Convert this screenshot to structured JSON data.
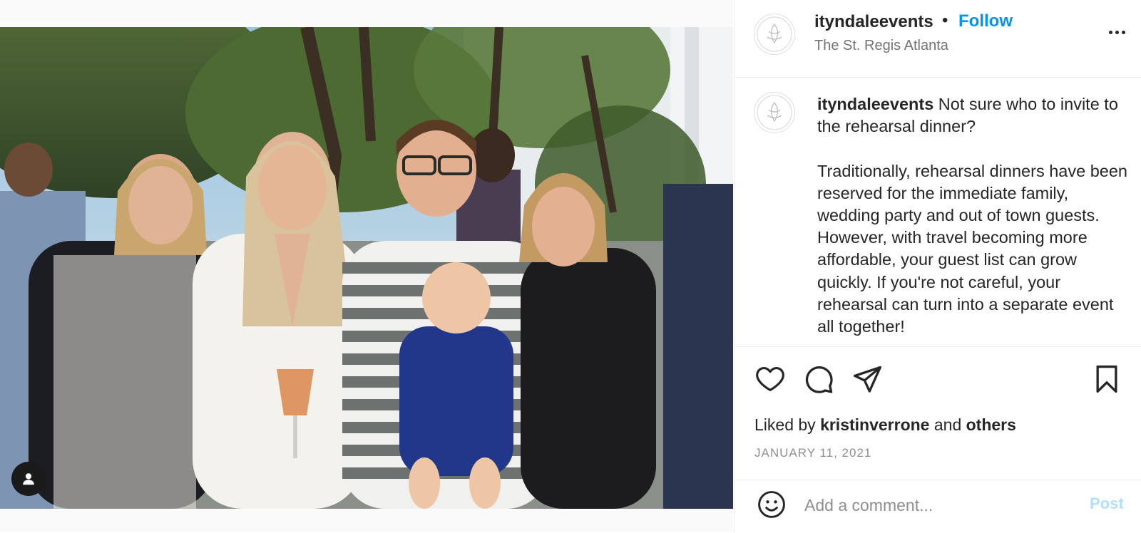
{
  "post": {
    "username": "ityndaleevents",
    "separator": "•",
    "follow_label": "Follow",
    "location": "The St. Regis Atlanta",
    "more_icon": "more-horizontal-icon",
    "avatar_icon": "brand-logo-avatar"
  },
  "caption": {
    "username": "ityndaleevents",
    "text": " Not sure who to invite to the rehearsal dinner?\n\nTraditionally, rehearsal dinners have been reserved for the immediate family, wedding party and out of town guests. However, with travel becoming more affordable, your guest list can grow quickly. If you're not careful, your rehearsal can turn into a separate event all together!"
  },
  "actions": {
    "like_icon": "heart-icon",
    "comment_icon": "comment-icon",
    "share_icon": "paper-plane-icon",
    "save_icon": "bookmark-icon"
  },
  "likes": {
    "prefix": "Liked by ",
    "user": "kristinverrone",
    "middle": " and ",
    "others": "others"
  },
  "date": "JANUARY 11, 2021",
  "comment": {
    "placeholder": "Add a comment...",
    "post_label": "Post",
    "emoji_icon": "smiley-icon"
  },
  "media": {
    "tag_icon": "user-tag-icon"
  },
  "colors": {
    "link_blue": "#0095f6",
    "post_disabled": "#b2dffc",
    "secondary_text": "#737373",
    "border": "#efefef"
  }
}
